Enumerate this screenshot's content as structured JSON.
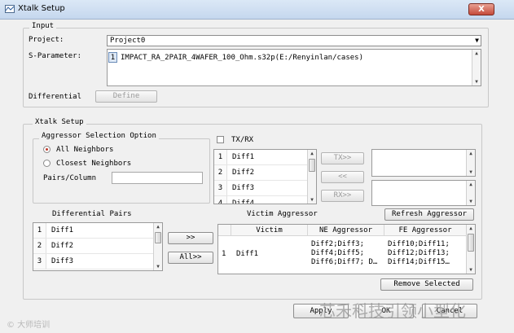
{
  "window": {
    "title": "Xtalk Setup",
    "close_label": "X"
  },
  "input_group": {
    "label": "Input",
    "project_label": "Project:",
    "project_value": "Project0",
    "sparam_label": "S-Parameter:",
    "sparam_index": "1",
    "sparam_value": "IMPACT_RA_2PAIR_4WAFER_100_Ohm.s32p(E:/Renyinlan/cases)",
    "differential_label": "Differential",
    "define_label": "Define"
  },
  "xtalk_group": {
    "label": "Xtalk Setup",
    "aggressor_group": {
      "label": "Aggressor Selection Option",
      "option_all": "All Neighbors",
      "option_closest": "Closest Neighbors",
      "pairs_column_label": "Pairs/Column",
      "pairs_column_value": ""
    },
    "txrx_label": "TX/RX",
    "txrx_list": [
      {
        "index": "1",
        "value": "Diff1"
      },
      {
        "index": "2",
        "value": "Diff2"
      },
      {
        "index": "3",
        "value": "Diff3"
      },
      {
        "index": "4",
        "value": "Diff4"
      }
    ],
    "tx_button": "TX>>",
    "back_button": "<<",
    "rx_button": "RX>>",
    "diff_pairs_label": "Differential Pairs",
    "diff_pairs": [
      {
        "index": "1",
        "value": "Diff1"
      },
      {
        "index": "2",
        "value": "Diff2"
      },
      {
        "index": "3",
        "value": "Diff3"
      }
    ],
    "add_button": ">>",
    "add_all_button": "All>>",
    "victim_aggressor_label": "Victim Aggressor",
    "refresh_button": "Refresh Aggressor",
    "table_headers": [
      "Victim",
      "NE Aggressor",
      "FE Aggressor"
    ],
    "table_rows": [
      {
        "index": "1",
        "victim": "Diff1",
        "ne": [
          "Diff2;Diff3;",
          "Diff4;Diff5;",
          "Diff6;Diff7; D…"
        ],
        "fe": [
          "Diff10;Diff11;",
          "Diff12;Diff13;",
          "Diff14;Diff15…"
        ]
      }
    ],
    "remove_button": "Remove Selected"
  },
  "footer": {
    "apply_label": "Apply",
    "ok_label": "OK",
    "cancel_label": "Cancel"
  },
  "watermarks": {
    "left": "© 大师培训",
    "right": "芯禾科技引领小型化"
  },
  "colors": {
    "accent_red": "#c0392b",
    "titlebar": "#c5d7ee"
  }
}
